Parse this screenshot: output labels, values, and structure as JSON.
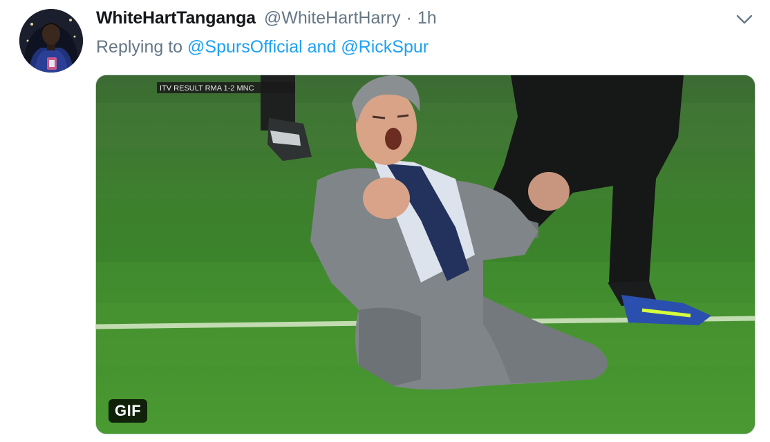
{
  "tweet": {
    "display_name": "WhiteHartTanganga",
    "handle": "@WhiteHartHarry",
    "separator": "·",
    "time": "1h",
    "reply": {
      "prefix": "Replying to ",
      "mention1": "@SpursOfficial",
      "conjunction": " and ",
      "mention2": "@RickSpur"
    },
    "media": {
      "badge": "GIF",
      "scoreboard": "ITV  RESULT  RMA 1-2 MNC"
    }
  },
  "icons": {
    "menu": "chevron-down-icon"
  },
  "colors": {
    "text_primary": "#14171a",
    "text_secondary": "#657786",
    "link": "#1da1f2",
    "border": "#ccd6dd",
    "pitch_green": "#3e7a2c"
  }
}
